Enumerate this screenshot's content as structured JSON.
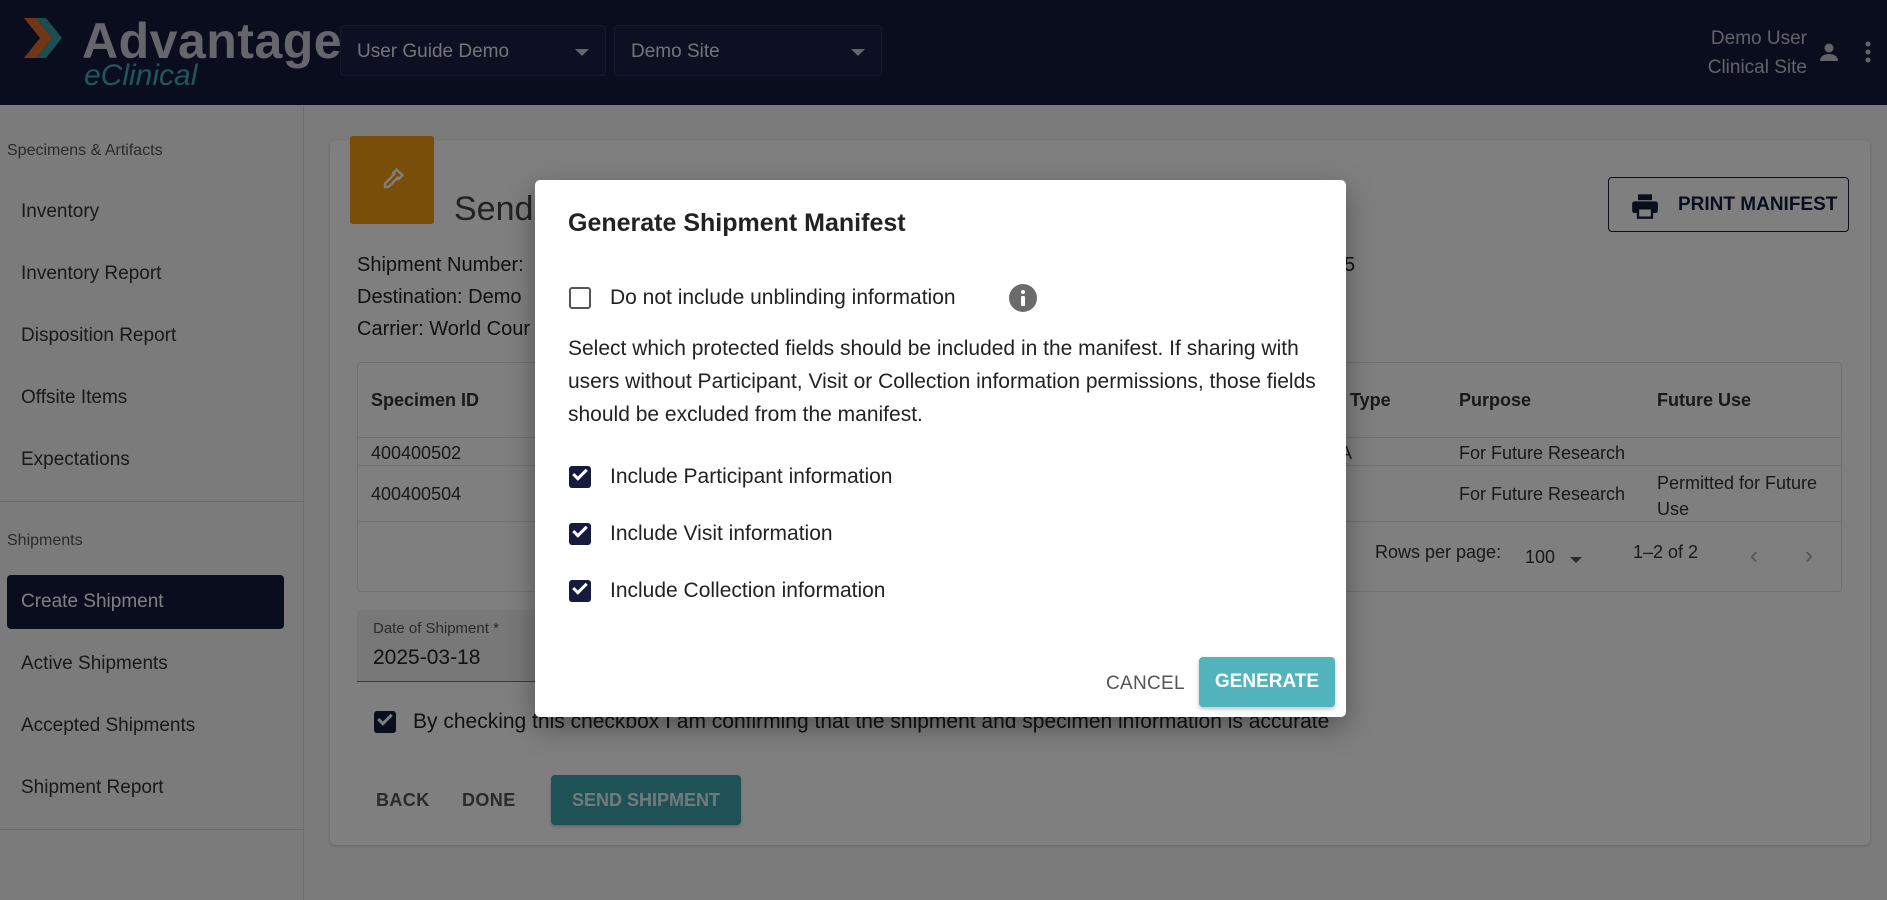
{
  "header": {
    "logo_main": "Advantage",
    "logo_sub": "eClinical",
    "study_select": "User Guide Demo",
    "site_select": "Demo Site",
    "user_name": "Demo User",
    "user_role": "Clinical Site"
  },
  "sidebar": {
    "section1": "Specimens & Artifacts",
    "items1": [
      "Inventory",
      "Inventory Report",
      "Disposition Report",
      "Offsite Items",
      "Expectations"
    ],
    "section2": "Shipments",
    "items2": [
      "Create Shipment",
      "Active Shipments",
      "Accepted Shipments",
      "Shipment Report"
    ],
    "active_item": "Create Shipment"
  },
  "page": {
    "title": "Send",
    "print_button": "PRINT MANIFEST",
    "shipment_number_label": "Shipment Number:",
    "destination_label": "Destination: Demo",
    "carrier_label": "Carrier: World Cour",
    "shipment_number_tail": "5"
  },
  "table": {
    "headers": {
      "specimen_id": "Specimen ID",
      "type": "Type",
      "purpose": "Purpose",
      "future_use": "Future Use"
    },
    "rows": [
      {
        "specimen_id": "400400502",
        "type": "IA",
        "purpose": "For Future Research",
        "future_use": ""
      },
      {
        "specimen_id": "400400504",
        "type": "",
        "purpose": "For Future Research",
        "future_use": "Permitted for Future Use"
      }
    ],
    "rows_per_page_label": "Rows per page:",
    "rows_per_page_value": "100",
    "range": "1–2 of 2"
  },
  "form": {
    "date_label": "Date of Shipment *",
    "date_value": "2025-03-18",
    "confirm_text": "By checking this checkbox I am confirming that the shipment and specimen information is accurate",
    "confirm_checked": true,
    "back": "BACK",
    "done": "DONE",
    "send": "SEND SHIPMENT"
  },
  "modal": {
    "title": "Generate Shipment Manifest",
    "unblinding_label": "Do not include unblinding information",
    "unblinding_checked": false,
    "description": "Select which protected fields should be included in the manifest. If sharing with users without Participant, Visit or Collection information permissions, those fields should be excluded from the manifest.",
    "option_participant": "Include Participant information",
    "option_visit": "Include Visit information",
    "option_collection": "Include Collection information",
    "cancel": "CANCEL",
    "generate": "GENERATE"
  },
  "colors": {
    "navy": "#141b3d",
    "teal": "#52b4bc",
    "orange": "#f39c12"
  }
}
